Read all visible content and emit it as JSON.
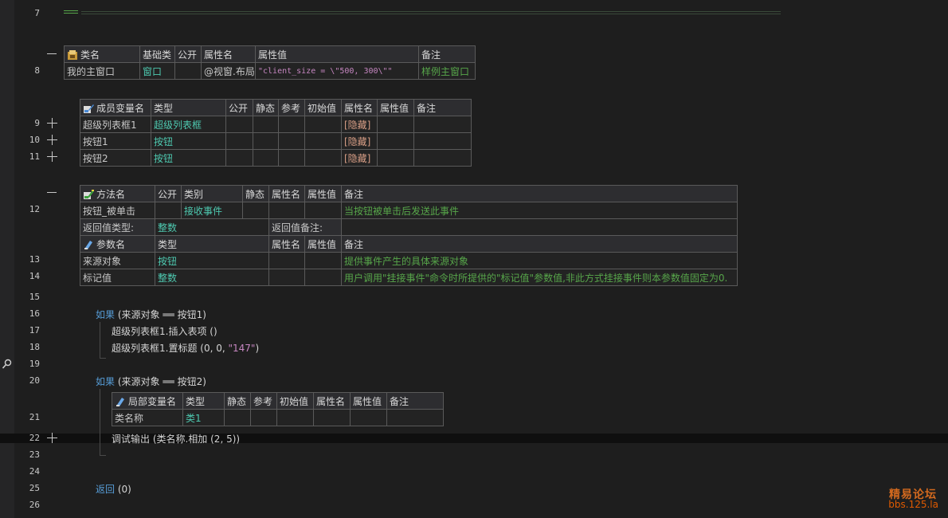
{
  "line_numbers": [
    "7",
    "8",
    "9",
    "10",
    "11",
    "12",
    "13",
    "14",
    "15",
    "16",
    "17",
    "18",
    "19",
    "20",
    "21",
    "22",
    "23",
    "24",
    "25",
    "26"
  ],
  "class_table": {
    "headers": [
      "类名",
      "基础类",
      "公开",
      "属性名",
      "属性值",
      "备注"
    ],
    "row": [
      "我的主窗口",
      "窗口",
      "",
      "@视窗.布局",
      "\"client_size = \\\"500, 300\\\"\"",
      "样例主窗口"
    ]
  },
  "member_table": {
    "headers": [
      "成员变量名",
      "类型",
      "公开",
      "静态",
      "参考",
      "初始值",
      "属性名",
      "属性值",
      "备注"
    ],
    "rows": [
      [
        "超级列表框1",
        "超级列表框",
        "",
        "",
        "",
        "",
        "[隐藏]",
        "",
        ""
      ],
      [
        "按钮1",
        "按钮",
        "",
        "",
        "",
        "",
        "[隐藏]",
        "",
        ""
      ],
      [
        "按钮2",
        "按钮",
        "",
        "",
        "",
        "",
        "[隐藏]",
        "",
        ""
      ]
    ]
  },
  "method_table": {
    "headers": [
      "方法名",
      "公开",
      "类别",
      "静态",
      "属性名",
      "属性值",
      "备注"
    ],
    "row": [
      "按钮_被单击",
      "",
      "接收事件",
      "",
      "",
      "",
      "当按钮被单击后发送此事件"
    ],
    "return_type_label": "返回值类型:",
    "return_type": "整数",
    "return_note_label": "返回值备注:",
    "return_note": "",
    "param_headers": [
      "参数名",
      "类型",
      "属性名",
      "属性值",
      "备注"
    ],
    "params": [
      [
        "来源对象",
        "按钮",
        "",
        "",
        "提供事件产生的具体来源对象"
      ],
      [
        "标记值",
        "整数",
        "",
        "",
        "用户调用\"挂接事件\"命令时所提供的\"标记值\"参数值,非此方式挂接事件则本参数值固定为0."
      ]
    ]
  },
  "code": {
    "if1_kw": "如果",
    "if1_cond": " (来源对象 ══ 按钮1)",
    "l17": "超级列表框1.插入表项 ()",
    "l18_pre": "超级列表框1.置标题 (0, 0, ",
    "l18_str": "\"147\"",
    "l18_post": ")",
    "if2_kw": "如果",
    "if2_cond": " (来源对象 ══ 按钮2)",
    "l22": "调试输出 (类名称.相加 (2, 5))",
    "ret_kw": "返回",
    "ret_val": " (0)"
  },
  "local_table": {
    "headers": [
      "局部变量名",
      "类型",
      "静态",
      "参考",
      "初始值",
      "属性名",
      "属性值",
      "备注"
    ],
    "row": [
      "类名称",
      "类1",
      "",
      "",
      "",
      "",
      "",
      ""
    ]
  },
  "watermark": {
    "line1": "精易论坛",
    "line2": "bbs.125.la"
  },
  "colors": {
    "type_cyan": "#4ec9b0",
    "comment_green": "#57a64a",
    "keyword_blue": "#569cd6",
    "string_purple": "#c586c0",
    "hidden_orange": "#d69d85"
  }
}
